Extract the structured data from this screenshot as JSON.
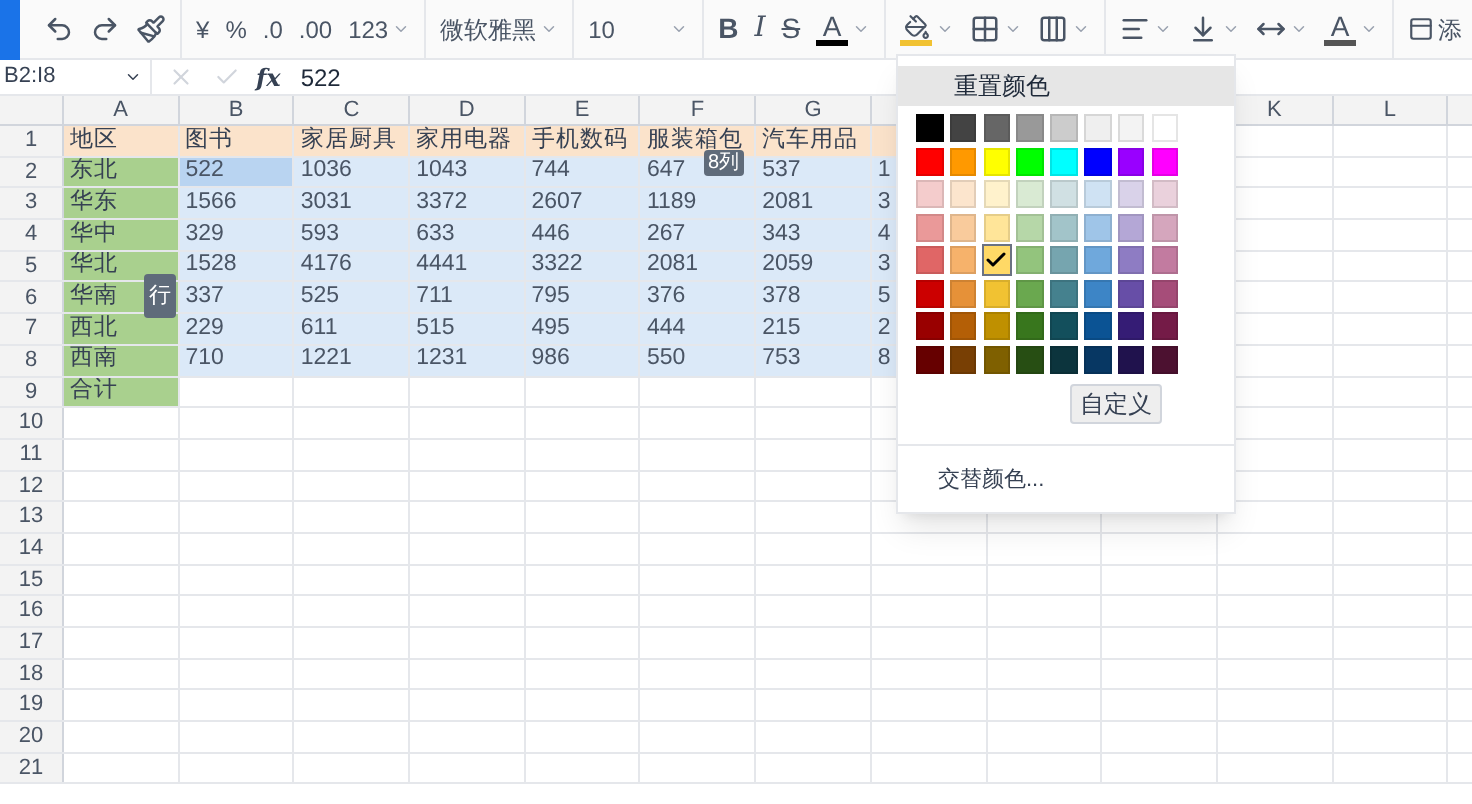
{
  "toolbar": [
    {
      "kind": "brand"
    },
    {
      "kind": "undo"
    },
    {
      "kind": "redo"
    },
    {
      "kind": "paint-format"
    },
    {
      "kind": "sep"
    },
    {
      "kind": "text",
      "label": "¥"
    },
    {
      "kind": "text",
      "label": "%"
    },
    {
      "kind": "text",
      "label": ".0"
    },
    {
      "kind": "text",
      "label": ".00"
    },
    {
      "kind": "dropdown",
      "label": "123"
    },
    {
      "kind": "sep"
    },
    {
      "kind": "select",
      "label": "微软雅黑"
    },
    {
      "kind": "sep"
    },
    {
      "kind": "select",
      "label": "10"
    },
    {
      "kind": "sep"
    },
    {
      "kind": "bold",
      "label": "B"
    },
    {
      "kind": "italic",
      "label": "I"
    },
    {
      "kind": "strike",
      "label": "S"
    },
    {
      "kind": "text-color",
      "label": "A",
      "color": "#000000"
    },
    {
      "kind": "sep"
    },
    {
      "kind": "fill-color",
      "color": "#f1c232"
    },
    {
      "kind": "borders"
    },
    {
      "kind": "merge"
    },
    {
      "kind": "sep"
    },
    {
      "kind": "align"
    },
    {
      "kind": "valign"
    },
    {
      "kind": "hspace"
    },
    {
      "kind": "text-color",
      "label": "A",
      "color": "#555555"
    },
    {
      "kind": "sep"
    },
    {
      "kind": "more",
      "label": "添"
    }
  ],
  "formula_bar": {
    "name_box": "B2:I8",
    "function_label": "fx",
    "formula": "522"
  },
  "columns": [
    {
      "label": "A"
    },
    {
      "label": "B"
    },
    {
      "label": "C"
    },
    {
      "label": "D"
    },
    {
      "label": "E"
    },
    {
      "label": "F"
    },
    {
      "label": "G"
    },
    {},
    {},
    {},
    {
      "label": "K"
    },
    {
      "label": "L"
    }
  ],
  "rows": [
    {
      "number": "1",
      "cells": [
        {
          "text": "地区",
          "kind": "header"
        },
        {
          "text": "图书",
          "kind": "header"
        },
        {
          "text": "家居厨具",
          "kind": "header"
        },
        {
          "text": "家用电器",
          "kind": "header"
        },
        {
          "text": "手机数码",
          "kind": "header"
        },
        {
          "text": "服装箱包",
          "kind": "header"
        },
        {
          "text": "汽车用品",
          "kind": "header"
        },
        {
          "kind": "header"
        }
      ]
    },
    {
      "number": "2",
      "cells": [
        {
          "text": "东北",
          "kind": "region"
        },
        {
          "text": "522",
          "kind": "active"
        },
        {
          "text": "1036",
          "kind": "selected"
        },
        {
          "text": "1043",
          "kind": "selected"
        },
        {
          "text": "744",
          "kind": "selected"
        },
        {
          "text": "647",
          "kind": "selected"
        },
        {
          "text": "537",
          "kind": "selected"
        },
        {
          "text": "1",
          "kind": "selected"
        }
      ]
    },
    {
      "number": "3",
      "cells": [
        {
          "text": "华东",
          "kind": "region"
        },
        {
          "text": "1566",
          "kind": "selected"
        },
        {
          "text": "3031",
          "kind": "selected"
        },
        {
          "text": "3372",
          "kind": "selected"
        },
        {
          "text": "2607",
          "kind": "selected"
        },
        {
          "text": "1189",
          "kind": "selected"
        },
        {
          "text": "2081",
          "kind": "selected"
        },
        {
          "text": "3",
          "kind": "selected"
        }
      ]
    },
    {
      "number": "4",
      "cells": [
        {
          "text": "华中",
          "kind": "region"
        },
        {
          "text": "329",
          "kind": "selected"
        },
        {
          "text": "593",
          "kind": "selected"
        },
        {
          "text": "633",
          "kind": "selected"
        },
        {
          "text": "446",
          "kind": "selected"
        },
        {
          "text": "267",
          "kind": "selected"
        },
        {
          "text": "343",
          "kind": "selected"
        },
        {
          "text": "4",
          "kind": "selected"
        }
      ]
    },
    {
      "number": "5",
      "cells": [
        {
          "text": "华北",
          "kind": "region"
        },
        {
          "text": "1528",
          "kind": "selected"
        },
        {
          "text": "4176",
          "kind": "selected"
        },
        {
          "text": "4441",
          "kind": "selected"
        },
        {
          "text": "3322",
          "kind": "selected"
        },
        {
          "text": "2081",
          "kind": "selected"
        },
        {
          "text": "2059",
          "kind": "selected"
        },
        {
          "text": "3",
          "kind": "selected"
        }
      ]
    },
    {
      "number": "6",
      "cells": [
        {
          "text": "华南",
          "kind": "region"
        },
        {
          "text": "337",
          "kind": "selected"
        },
        {
          "text": "525",
          "kind": "selected"
        },
        {
          "text": "711",
          "kind": "selected"
        },
        {
          "text": "795",
          "kind": "selected"
        },
        {
          "text": "376",
          "kind": "selected"
        },
        {
          "text": "378",
          "kind": "selected"
        },
        {
          "text": "5",
          "kind": "selected"
        }
      ]
    },
    {
      "number": "7",
      "cells": [
        {
          "text": "西北",
          "kind": "region"
        },
        {
          "text": "229",
          "kind": "selected"
        },
        {
          "text": "611",
          "kind": "selected"
        },
        {
          "text": "515",
          "kind": "selected"
        },
        {
          "text": "495",
          "kind": "selected"
        },
        {
          "text": "444",
          "kind": "selected"
        },
        {
          "text": "215",
          "kind": "selected"
        },
        {
          "text": "2",
          "kind": "selected"
        }
      ]
    },
    {
      "number": "8",
      "cells": [
        {
          "text": "西南",
          "kind": "region"
        },
        {
          "text": "710",
          "kind": "selected"
        },
        {
          "text": "1221",
          "kind": "selected"
        },
        {
          "text": "1231",
          "kind": "selected"
        },
        {
          "text": "986",
          "kind": "selected"
        },
        {
          "text": "550",
          "kind": "selected"
        },
        {
          "text": "753",
          "kind": "selected"
        },
        {
          "text": "8",
          "kind": "selected"
        }
      ]
    },
    {
      "number": "9",
      "cells": [
        {
          "text": "合计",
          "kind": "region"
        }
      ]
    },
    {
      "number": "10"
    },
    {
      "number": "11"
    },
    {
      "number": "12"
    },
    {
      "number": "13"
    },
    {
      "number": "14"
    },
    {
      "number": "15"
    },
    {
      "number": "16"
    },
    {
      "number": "17"
    },
    {
      "number": "18"
    },
    {
      "number": "19"
    },
    {
      "number": "20"
    },
    {
      "number": "21"
    }
  ],
  "column_tip": "8列",
  "row_tip": "行",
  "menu": {
    "reset": "重置颜色",
    "swatches": [
      {
        "color": "#000000",
        "selected": false
      },
      {
        "color": "#434343",
        "selected": false
      },
      {
        "color": "#666666",
        "selected": false
      },
      {
        "color": "#999999",
        "selected": false
      },
      {
        "color": "#cccccc",
        "selected": false
      },
      {
        "color": "#efefef",
        "selected": false
      },
      {
        "color": "#f3f3f3",
        "selected": false
      },
      {
        "color": "#ffffff",
        "selected": false
      },
      {
        "color": "#ff0000",
        "selected": false
      },
      {
        "color": "#ff9900",
        "selected": false
      },
      {
        "color": "#ffff00",
        "selected": false
      },
      {
        "color": "#00ff00",
        "selected": false
      },
      {
        "color": "#00ffff",
        "selected": false
      },
      {
        "color": "#0000ff",
        "selected": false
      },
      {
        "color": "#9900ff",
        "selected": false
      },
      {
        "color": "#ff00ff",
        "selected": false
      },
      {
        "color": "#f4cccc",
        "selected": false
      },
      {
        "color": "#fce5cd",
        "selected": false
      },
      {
        "color": "#fff2cc",
        "selected": false
      },
      {
        "color": "#d9ead3",
        "selected": false
      },
      {
        "color": "#d0e0e3",
        "selected": false
      },
      {
        "color": "#cfe2f3",
        "selected": false
      },
      {
        "color": "#d9d2e9",
        "selected": false
      },
      {
        "color": "#ead1dc",
        "selected": false
      },
      {
        "color": "#ea9999",
        "selected": false
      },
      {
        "color": "#f9cb9c",
        "selected": false
      },
      {
        "color": "#ffe599",
        "selected": false
      },
      {
        "color": "#b6d7a8",
        "selected": false
      },
      {
        "color": "#a2c4c9",
        "selected": false
      },
      {
        "color": "#9fc5e8",
        "selected": false
      },
      {
        "color": "#b4a7d6",
        "selected": false
      },
      {
        "color": "#d5a6bd",
        "selected": false
      },
      {
        "color": "#e06666",
        "selected": false
      },
      {
        "color": "#f6b26b",
        "selected": false
      },
      {
        "color": "#ffd966",
        "selected": true
      },
      {
        "color": "#93c47d",
        "selected": false
      },
      {
        "color": "#76a5af",
        "selected": false
      },
      {
        "color": "#6fa8dc",
        "selected": false
      },
      {
        "color": "#8e7cc3",
        "selected": false
      },
      {
        "color": "#c27ba0",
        "selected": false
      },
      {
        "color": "#cc0000",
        "selected": false
      },
      {
        "color": "#e69138",
        "selected": false
      },
      {
        "color": "#f1c232",
        "selected": false
      },
      {
        "color": "#6aa84f",
        "selected": false
      },
      {
        "color": "#45818e",
        "selected": false
      },
      {
        "color": "#3d85c6",
        "selected": false
      },
      {
        "color": "#674ea7",
        "selected": false
      },
      {
        "color": "#a64d79",
        "selected": false
      },
      {
        "color": "#990000",
        "selected": false
      },
      {
        "color": "#b45f06",
        "selected": false
      },
      {
        "color": "#bf9000",
        "selected": false
      },
      {
        "color": "#38761d",
        "selected": false
      },
      {
        "color": "#134f5c",
        "selected": false
      },
      {
        "color": "#0b5394",
        "selected": false
      },
      {
        "color": "#351c75",
        "selected": false
      },
      {
        "color": "#741b47",
        "selected": false
      },
      {
        "color": "#660000",
        "selected": false
      },
      {
        "color": "#783f04",
        "selected": false
      },
      {
        "color": "#7f6000",
        "selected": false
      },
      {
        "color": "#274e13",
        "selected": false
      },
      {
        "color": "#0c343d",
        "selected": false
      },
      {
        "color": "#073763",
        "selected": false
      },
      {
        "color": "#20124d",
        "selected": false
      },
      {
        "color": "#4c1130",
        "selected": false
      }
    ],
    "custom": "自定义",
    "alternate": "交替颜色..."
  }
}
